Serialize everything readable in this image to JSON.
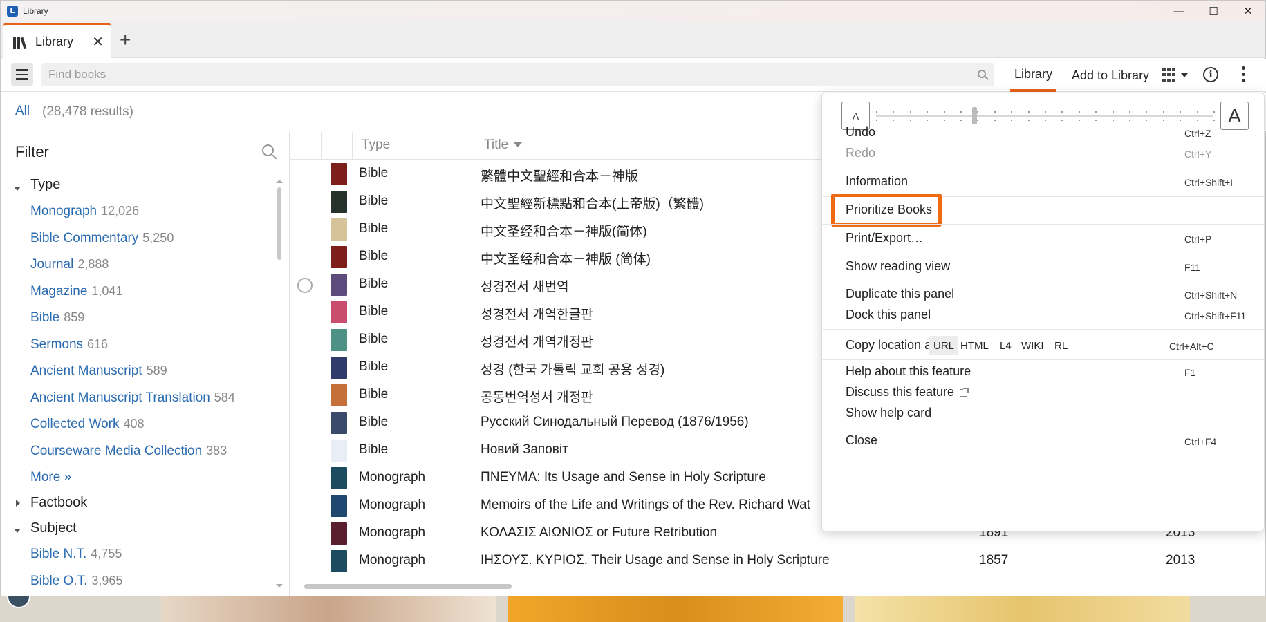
{
  "window": {
    "title": "Library",
    "min": "—",
    "max": "☐",
    "close": "✕"
  },
  "tab": {
    "label": "Library",
    "close": "✕",
    "add": "+"
  },
  "toolbar": {
    "search_placeholder": "Find books",
    "library_tab": "Library",
    "add_to_library": "Add to Library",
    "info": "i"
  },
  "results": {
    "all": "All",
    "count": "(28,478 results)"
  },
  "filter": {
    "title": "Filter",
    "groups": {
      "type": "Type",
      "factbook": "Factbook",
      "subject": "Subject"
    },
    "type_items": [
      {
        "label": "Monograph",
        "count": "12,026"
      },
      {
        "label": "Bible Commentary",
        "count": "5,250"
      },
      {
        "label": "Journal",
        "count": "2,888"
      },
      {
        "label": "Magazine",
        "count": "1,041"
      },
      {
        "label": "Bible",
        "count": "859"
      },
      {
        "label": "Sermons",
        "count": "616"
      },
      {
        "label": "Ancient Manuscript",
        "count": "589"
      },
      {
        "label": "Ancient Manuscript Translation",
        "count": "584"
      },
      {
        "label": "Collected Work",
        "count": "408"
      },
      {
        "label": "Courseware Media Collection",
        "count": "383"
      }
    ],
    "more": "More »",
    "subject_items": [
      {
        "label": "Bible N.T.",
        "count": "4,755"
      },
      {
        "label": "Bible O.T.",
        "count": "3,965"
      }
    ]
  },
  "table": {
    "headers": {
      "type": "Type",
      "title": "Title"
    },
    "rows": [
      {
        "type": "Bible",
        "title": "繁體中文聖經和合本－神版",
        "cover": "#7d1e1a",
        "y1": "",
        "y2": ""
      },
      {
        "type": "Bible",
        "title": "中文聖經新標點和合本(上帝版)（繁體)",
        "cover": "#26332b",
        "y1": "",
        "y2": ""
      },
      {
        "type": "Bible",
        "title": "中文圣经和合本－神版(简体)",
        "cover": "#d7c39a",
        "y1": "",
        "y2": ""
      },
      {
        "type": "Bible",
        "title": "中文圣经和合本－神版 (简体)",
        "cover": "#7d1e1a",
        "y1": "",
        "y2": ""
      },
      {
        "type": "Bible",
        "title": "성경전서 새번역",
        "cover": "#5e4b7e",
        "y1": "",
        "y2": ""
      },
      {
        "type": "Bible",
        "title": "성경전서 개역한글판",
        "cover": "#c94d6c",
        "y1": "",
        "y2": ""
      },
      {
        "type": "Bible",
        "title": "성경전서 개역개정판",
        "cover": "#4e9187",
        "y1": "",
        "y2": ""
      },
      {
        "type": "Bible",
        "title": "성경 (한국 가톨릭 교회 공용 성경)",
        "cover": "#2f3c6b",
        "y1": "",
        "y2": ""
      },
      {
        "type": "Bible",
        "title": "공동번역성서 개정판",
        "cover": "#c5703a",
        "y1": "",
        "y2": ""
      },
      {
        "type": "Bible",
        "title": "Русский Синодальный Перевод (1876/1956)",
        "cover": "#3a4a6b",
        "y1": "",
        "y2": ""
      },
      {
        "type": "Bible",
        "title": "Новий Заповіт",
        "cover": "#e9edf5",
        "y1": "",
        "y2": ""
      },
      {
        "type": "Monograph",
        "title": "ΠΝΕΥΜΑ: Its Usage and Sense in Holy Scripture",
        "cover": "#1c4a5e",
        "y1": "",
        "y2": ""
      },
      {
        "type": "Monograph",
        "title": "Memoirs of the Life and Writings of the Rev. Richard Wat",
        "cover": "#1f4770",
        "y1": "",
        "y2": ""
      },
      {
        "type": "Monograph",
        "title": "ΚΟΛΑΣΙΣ ΑΙΩΝΙΟΣ or Future Retribution",
        "cover": "#5a1f2e",
        "y1": "1891",
        "y2": "2013"
      },
      {
        "type": "Monograph",
        "title": "ΙΗΣΟΥΣ. ΚΥΡΙΟΣ. Their Usage and Sense in Holy Scripture",
        "cover": "#1c4a5e",
        "y1": "1857",
        "y2": "2013"
      }
    ]
  },
  "menu": {
    "zoom_small": "A",
    "zoom_large": "A",
    "zoom_level": 0.29,
    "undo": "Undo",
    "undo_sc": "Ctrl+Z",
    "redo": "Redo",
    "redo_sc": "Ctrl+Y",
    "information": "Information",
    "information_sc": "Ctrl+Shift+I",
    "prioritize": "Prioritize Books",
    "print": "Print/Export…",
    "print_sc": "Ctrl+P",
    "reading_view": "Show reading view",
    "reading_view_sc": "F11",
    "duplicate": "Duplicate this panel",
    "duplicate_sc": "Ctrl+Shift+N",
    "dock": "Dock this panel",
    "dock_sc": "Ctrl+Shift+F11",
    "copy_location": "Copy location as:",
    "copy_formats": [
      "URL",
      "HTML",
      "L4",
      "WIKI",
      "RL"
    ],
    "copy_sc": "Ctrl+Alt+C",
    "help": "Help about this feature",
    "help_sc": "F1",
    "discuss": "Discuss this feature",
    "help_card": "Show help card",
    "close": "Close",
    "close_sc": "Ctrl+F4",
    "highlight_color": "#f06a12"
  }
}
